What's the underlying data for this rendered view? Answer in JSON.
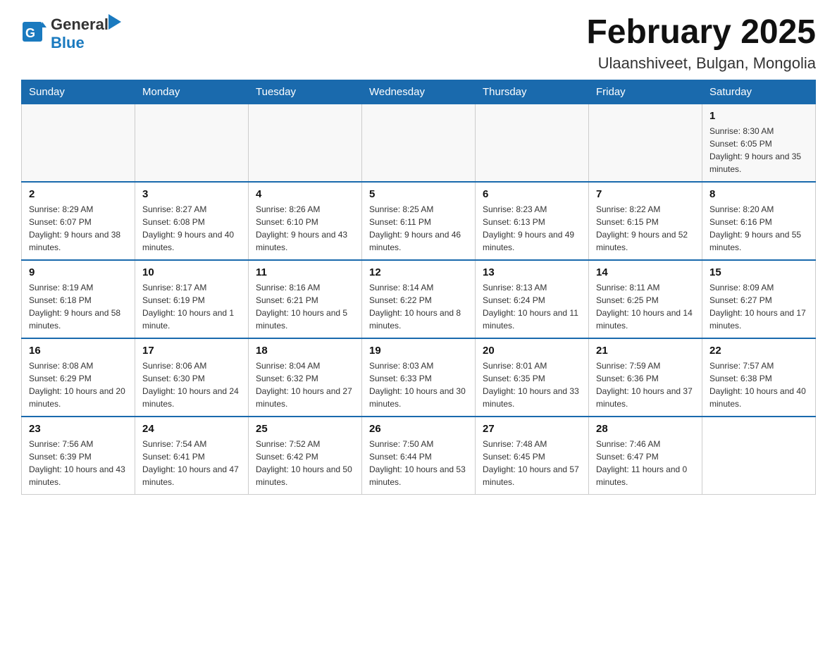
{
  "header": {
    "logo_general": "General",
    "logo_blue": "Blue",
    "title": "February 2025",
    "subtitle": "Ulaanshiveet, Bulgan, Mongolia"
  },
  "days_of_week": [
    "Sunday",
    "Monday",
    "Tuesday",
    "Wednesday",
    "Thursday",
    "Friday",
    "Saturday"
  ],
  "weeks": [
    [
      {
        "day": "",
        "info": ""
      },
      {
        "day": "",
        "info": ""
      },
      {
        "day": "",
        "info": ""
      },
      {
        "day": "",
        "info": ""
      },
      {
        "day": "",
        "info": ""
      },
      {
        "day": "",
        "info": ""
      },
      {
        "day": "1",
        "info": "Sunrise: 8:30 AM\nSunset: 6:05 PM\nDaylight: 9 hours and 35 minutes."
      }
    ],
    [
      {
        "day": "2",
        "info": "Sunrise: 8:29 AM\nSunset: 6:07 PM\nDaylight: 9 hours and 38 minutes."
      },
      {
        "day": "3",
        "info": "Sunrise: 8:27 AM\nSunset: 6:08 PM\nDaylight: 9 hours and 40 minutes."
      },
      {
        "day": "4",
        "info": "Sunrise: 8:26 AM\nSunset: 6:10 PM\nDaylight: 9 hours and 43 minutes."
      },
      {
        "day": "5",
        "info": "Sunrise: 8:25 AM\nSunset: 6:11 PM\nDaylight: 9 hours and 46 minutes."
      },
      {
        "day": "6",
        "info": "Sunrise: 8:23 AM\nSunset: 6:13 PM\nDaylight: 9 hours and 49 minutes."
      },
      {
        "day": "7",
        "info": "Sunrise: 8:22 AM\nSunset: 6:15 PM\nDaylight: 9 hours and 52 minutes."
      },
      {
        "day": "8",
        "info": "Sunrise: 8:20 AM\nSunset: 6:16 PM\nDaylight: 9 hours and 55 minutes."
      }
    ],
    [
      {
        "day": "9",
        "info": "Sunrise: 8:19 AM\nSunset: 6:18 PM\nDaylight: 9 hours and 58 minutes."
      },
      {
        "day": "10",
        "info": "Sunrise: 8:17 AM\nSunset: 6:19 PM\nDaylight: 10 hours and 1 minute."
      },
      {
        "day": "11",
        "info": "Sunrise: 8:16 AM\nSunset: 6:21 PM\nDaylight: 10 hours and 5 minutes."
      },
      {
        "day": "12",
        "info": "Sunrise: 8:14 AM\nSunset: 6:22 PM\nDaylight: 10 hours and 8 minutes."
      },
      {
        "day": "13",
        "info": "Sunrise: 8:13 AM\nSunset: 6:24 PM\nDaylight: 10 hours and 11 minutes."
      },
      {
        "day": "14",
        "info": "Sunrise: 8:11 AM\nSunset: 6:25 PM\nDaylight: 10 hours and 14 minutes."
      },
      {
        "day": "15",
        "info": "Sunrise: 8:09 AM\nSunset: 6:27 PM\nDaylight: 10 hours and 17 minutes."
      }
    ],
    [
      {
        "day": "16",
        "info": "Sunrise: 8:08 AM\nSunset: 6:29 PM\nDaylight: 10 hours and 20 minutes."
      },
      {
        "day": "17",
        "info": "Sunrise: 8:06 AM\nSunset: 6:30 PM\nDaylight: 10 hours and 24 minutes."
      },
      {
        "day": "18",
        "info": "Sunrise: 8:04 AM\nSunset: 6:32 PM\nDaylight: 10 hours and 27 minutes."
      },
      {
        "day": "19",
        "info": "Sunrise: 8:03 AM\nSunset: 6:33 PM\nDaylight: 10 hours and 30 minutes."
      },
      {
        "day": "20",
        "info": "Sunrise: 8:01 AM\nSunset: 6:35 PM\nDaylight: 10 hours and 33 minutes."
      },
      {
        "day": "21",
        "info": "Sunrise: 7:59 AM\nSunset: 6:36 PM\nDaylight: 10 hours and 37 minutes."
      },
      {
        "day": "22",
        "info": "Sunrise: 7:57 AM\nSunset: 6:38 PM\nDaylight: 10 hours and 40 minutes."
      }
    ],
    [
      {
        "day": "23",
        "info": "Sunrise: 7:56 AM\nSunset: 6:39 PM\nDaylight: 10 hours and 43 minutes."
      },
      {
        "day": "24",
        "info": "Sunrise: 7:54 AM\nSunset: 6:41 PM\nDaylight: 10 hours and 47 minutes."
      },
      {
        "day": "25",
        "info": "Sunrise: 7:52 AM\nSunset: 6:42 PM\nDaylight: 10 hours and 50 minutes."
      },
      {
        "day": "26",
        "info": "Sunrise: 7:50 AM\nSunset: 6:44 PM\nDaylight: 10 hours and 53 minutes."
      },
      {
        "day": "27",
        "info": "Sunrise: 7:48 AM\nSunset: 6:45 PM\nDaylight: 10 hours and 57 minutes."
      },
      {
        "day": "28",
        "info": "Sunrise: 7:46 AM\nSunset: 6:47 PM\nDaylight: 11 hours and 0 minutes."
      },
      {
        "day": "",
        "info": ""
      }
    ]
  ]
}
